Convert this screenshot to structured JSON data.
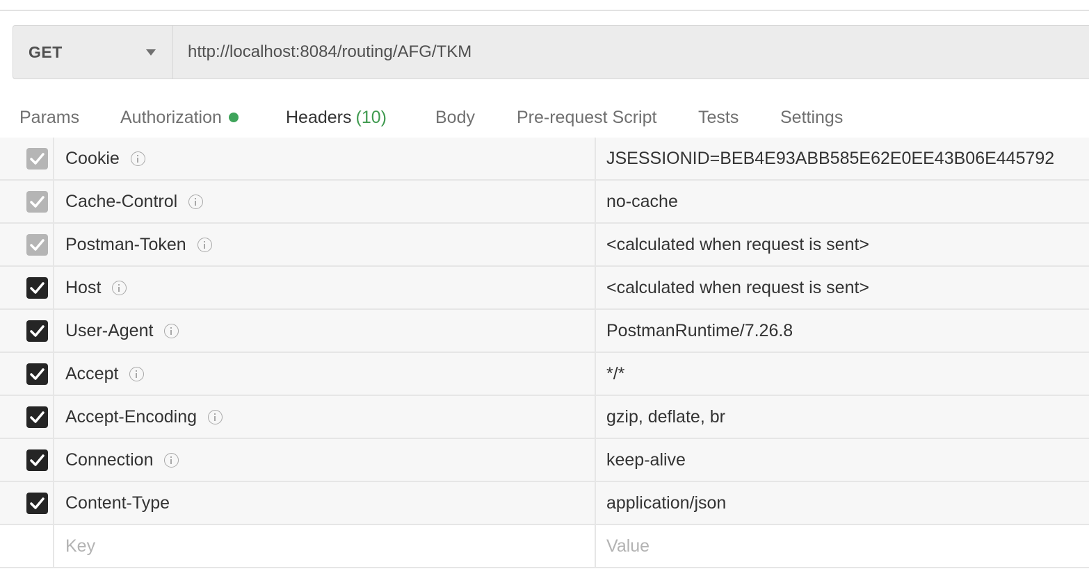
{
  "request": {
    "method": "GET",
    "url": "http://localhost:8084/routing/AFG/TKM"
  },
  "tabs": [
    {
      "label": "Params"
    },
    {
      "label": "Authorization"
    },
    {
      "label": "Headers",
      "count": "(10)"
    },
    {
      "label": "Body"
    },
    {
      "label": "Pre-request Script"
    },
    {
      "label": "Tests"
    },
    {
      "label": "Settings"
    }
  ],
  "active_tab": "Headers",
  "colors": {
    "active_tab_underline": "#e8714a",
    "auth_status_dot": "#3fa45b",
    "header_count": "#3f9a4f"
  },
  "headers": [
    {
      "key": "Cookie",
      "value": "JSESSIONID=BEB4E93ABB585E62E0EE43B06E445792",
      "checked": true,
      "auto": true
    },
    {
      "key": "Cache-Control",
      "value": "no-cache",
      "checked": true,
      "auto": true
    },
    {
      "key": "Postman-Token",
      "value": "<calculated when request is sent>",
      "checked": true,
      "auto": true
    },
    {
      "key": "Host",
      "value": "<calculated when request is sent>",
      "checked": true,
      "auto": false
    },
    {
      "key": "User-Agent",
      "value": "PostmanRuntime/7.26.8",
      "checked": true,
      "auto": false
    },
    {
      "key": "Accept",
      "value": "*/*",
      "checked": true,
      "auto": false
    },
    {
      "key": "Accept-Encoding",
      "value": "gzip, deflate, br",
      "checked": true,
      "auto": false
    },
    {
      "key": "Connection",
      "value": "keep-alive",
      "checked": true,
      "auto": false
    },
    {
      "key": "Content-Type",
      "value": "application/json",
      "checked": true,
      "auto": false
    }
  ],
  "new_row": {
    "key_placeholder": "Key",
    "value_placeholder": "Value"
  }
}
